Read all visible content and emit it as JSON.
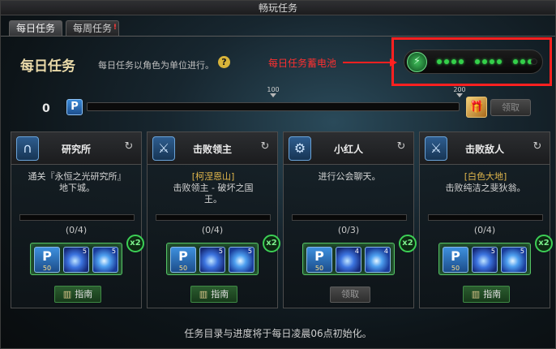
{
  "window": {
    "title": "畅玩任务"
  },
  "tabs": [
    {
      "label": "每日任务",
      "active": true
    },
    {
      "label": "每周任务",
      "badge": "!"
    }
  ],
  "header": {
    "title": "每日任务",
    "subtitle": "每日任务以角色为单位进行。",
    "help": "?"
  },
  "annotation": {
    "text": "每日任务蓄电池",
    "color": "#ff2020"
  },
  "battery": {
    "charge_groups": [
      4,
      4,
      3
    ],
    "filled": 11
  },
  "progress": {
    "current": "0",
    "icon": "P",
    "value": 0,
    "markers": [
      {
        "label": "100",
        "fraction": 0.5
      },
      {
        "label": "200",
        "fraction": 1.0
      }
    ],
    "claim_label": "领取"
  },
  "cards": [
    {
      "title": "研究所",
      "emblem": "gate-icon",
      "desc_lines": [
        "通关『永恒之光研究所』",
        "地下城。"
      ],
      "count": "(0/4)",
      "items": [
        "P 50",
        "5",
        "5"
      ],
      "p_num": "50",
      "orb1": "5",
      "orb2": "5",
      "bonus": "x2",
      "button": "指南"
    },
    {
      "title": "击败领主",
      "emblem": "sword-icon",
      "desc_lines": [
        "[柯涅恩山]",
        "击败领主 - 破坏之国",
        "王。"
      ],
      "count": "(0/4)",
      "p_num": "50",
      "orb1": "5",
      "orb2": "5",
      "bonus": "x2",
      "button": "指南"
    },
    {
      "title": "小红人",
      "emblem": "gear-icon",
      "desc_lines": [
        "进行公会聊天。"
      ],
      "count": "(0/3)",
      "p_num": "50",
      "orb1": "4",
      "orb2": "4",
      "bonus": "x2",
      "button": "领取"
    },
    {
      "title": "击败敌人",
      "emblem": "sword-icon",
      "desc_lines": [
        "[白色大地]",
        "击败纯洁之斐狄翁。"
      ],
      "count": "(0/4)",
      "p_num": "50",
      "orb1": "5",
      "orb2": "5",
      "bonus": "x2",
      "button": "指南"
    }
  ],
  "footer": "任务目录与进度将于每日凌晨06点初始化。"
}
